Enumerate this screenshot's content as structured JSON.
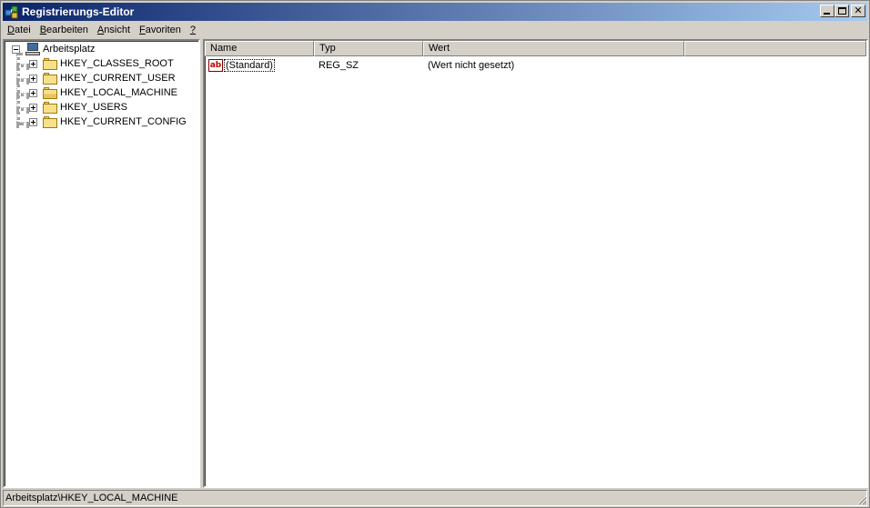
{
  "window": {
    "title": "Registrierungs-Editor",
    "controls": {
      "minimize": "minimize",
      "maximize": "maximize",
      "close": "✕"
    }
  },
  "menu": [
    {
      "pre": "",
      "ul": "D",
      "post": "atei"
    },
    {
      "pre": "",
      "ul": "B",
      "post": "earbeiten"
    },
    {
      "pre": "",
      "ul": "A",
      "post": "nsicht"
    },
    {
      "pre": "",
      "ul": "F",
      "post": "avoriten"
    },
    {
      "pre": "",
      "ul": "?",
      "post": ""
    }
  ],
  "tree": {
    "root": "Arbeitsplatz",
    "items": [
      {
        "label": "HKEY_CLASSES_ROOT",
        "open": false
      },
      {
        "label": "HKEY_CURRENT_USER",
        "open": false
      },
      {
        "label": "HKEY_LOCAL_MACHINE",
        "open": true
      },
      {
        "label": "HKEY_USERS",
        "open": false
      },
      {
        "label": "HKEY_CURRENT_CONFIG",
        "open": false
      }
    ]
  },
  "list": {
    "columns": [
      "Name",
      "Typ",
      "Wert"
    ],
    "rows": [
      {
        "icon": "ab",
        "name": "(Standard)",
        "type": "REG_SZ",
        "value": "(Wert nicht gesetzt)"
      }
    ]
  },
  "status": {
    "path": "Arbeitsplatz\\HKEY_LOCAL_MACHINE"
  },
  "icons": {
    "app": "registry-editor-icon",
    "root": "computer-icon",
    "folder": "folder-icon",
    "value": "string-value-icon"
  },
  "colors": {
    "titlebar_start": "#0a246a",
    "titlebar_end": "#a6caf0",
    "face": "#d4d0c8",
    "string_icon": "#c00000"
  }
}
